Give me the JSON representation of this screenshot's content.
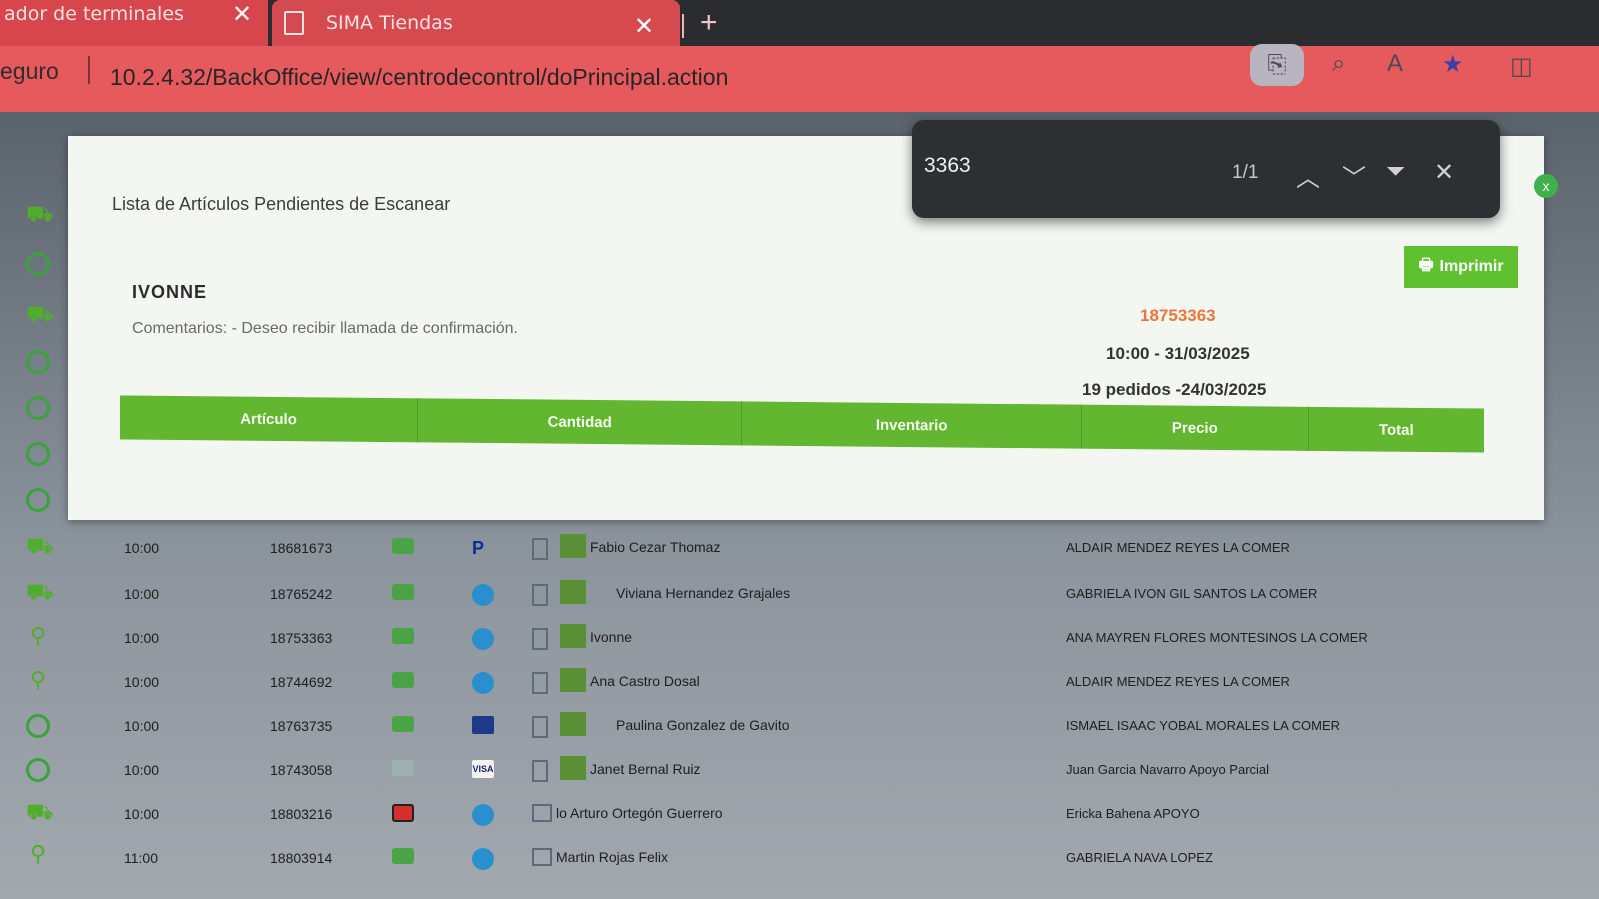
{
  "browser": {
    "tabs": [
      {
        "title": "ador de terminales"
      },
      {
        "title": "SIMA Tiendas"
      }
    ],
    "security_label": "eguro",
    "url": "10.2.4.32/BackOffice/view/centrodecontrol/doPrincipal.action"
  },
  "find_bar": {
    "query": "3363",
    "count": "1/1"
  },
  "modal": {
    "title": "Lista de Artículos Pendientes de Escanear",
    "close_label": "x",
    "print_label": "Imprimir",
    "customer_name": "IVONNE",
    "comments": "Comentarios:  - Deseo recibir llamada de confirmación.",
    "order_number": "18753363",
    "order_time": "10:00 - 31/03/2025",
    "order_count": "19 pedidos -24/03/2025",
    "columns": [
      "Artículo",
      "Cantidad",
      "Inventario",
      "Precio",
      "Total"
    ]
  },
  "rows": [
    {
      "time": "10:00",
      "id": "18681673",
      "name": "Fabio Cezar Thomaz",
      "agent": "ALDAIR MENDEZ REYES LA COMER"
    },
    {
      "time": "10:00",
      "id": "18765242",
      "name": "Viviana Hernandez Grajales",
      "agent": "GABRIELA IVON GIL SANTOS LA COMER"
    },
    {
      "time": "10:00",
      "id": "18753363",
      "name": "Ivonne",
      "agent": "ANA MAYREN FLORES MONTESINOS LA COMER"
    },
    {
      "time": "10:00",
      "id": "18744692",
      "name": "Ana Castro Dosal",
      "agent": "ALDAIR MENDEZ REYES LA COMER"
    },
    {
      "time": "10:00",
      "id": "18763735",
      "name": "Paulina Gonzalez de Gavito",
      "agent": "ISMAEL ISAAC YOBAL MORALES LA COMER"
    },
    {
      "time": "10:00",
      "id": "18743058",
      "name": "Janet Bernal Ruiz",
      "agent": "Juan Garcia Navarro Apoyo Parcial"
    },
    {
      "time": "10:00",
      "id": "18803216",
      "name": "lo Arturo Ortegón Guerrero",
      "agent": "Ericka Bahena APOYO"
    },
    {
      "time": "11:00",
      "id": "18803914",
      "name": "Martin Rojas Felix",
      "agent": "GABRIELA NAVA LOPEZ"
    }
  ],
  "colors": {
    "tab_red": "#d54a4e",
    "accent_green": "#62b630",
    "order_orange": "#e9773a"
  }
}
